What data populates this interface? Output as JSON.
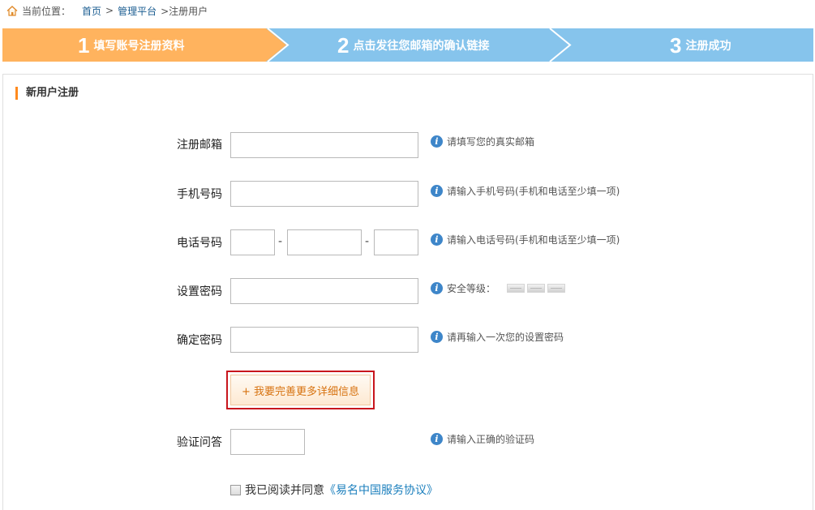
{
  "breadcrumb": {
    "prefix": "当前位置：",
    "items": [
      "首页",
      "管理平台"
    ],
    "separator": ">",
    "current": ">注册用户"
  },
  "steps": [
    {
      "number": "1",
      "label": "填写账号注册资料",
      "state": "active",
      "color": "#ffb35e"
    },
    {
      "number": "2",
      "label": "点击发往您邮箱的确认链接",
      "state": "pending",
      "color": "#86c4ec"
    },
    {
      "number": "3",
      "label": "注册成功",
      "state": "pending",
      "color": "#86c4ec"
    }
  ],
  "panel": {
    "title": "新用户注册"
  },
  "form": {
    "email": {
      "label": "注册邮箱",
      "value": "",
      "hint": "请填写您的真实邮箱"
    },
    "mobile": {
      "label": "手机号码",
      "value": "",
      "hint": "请输入手机号码(手机和电话至少填一项)"
    },
    "phone": {
      "label": "电话号码",
      "area": "",
      "number": "",
      "ext": "",
      "dash": "-",
      "hint": "请输入电话号码(手机和电话至少填一项)"
    },
    "password": {
      "label": "设置密码",
      "value": "",
      "hint": "安全等级："
    },
    "confirm": {
      "label": "确定密码",
      "value": "",
      "hint": "请再输入一次您的设置密码"
    },
    "more_button": "+ 我要完善更多详细信息",
    "captcha": {
      "label": "验证问答",
      "value": "",
      "hint": "请输入正确的验证码"
    },
    "agree": {
      "text": "我已阅读并同意",
      "link": "《易名中国服务协议》",
      "checked": false
    }
  },
  "icons": {
    "home": "home-icon",
    "info": "info-icon",
    "info_glyph": "i"
  },
  "colors": {
    "accent": "#ff8a1e",
    "step_active": "#ffb35e",
    "step_pending": "#86c4ec",
    "link": "#1b5d91",
    "highlight_border": "#c8161d"
  }
}
